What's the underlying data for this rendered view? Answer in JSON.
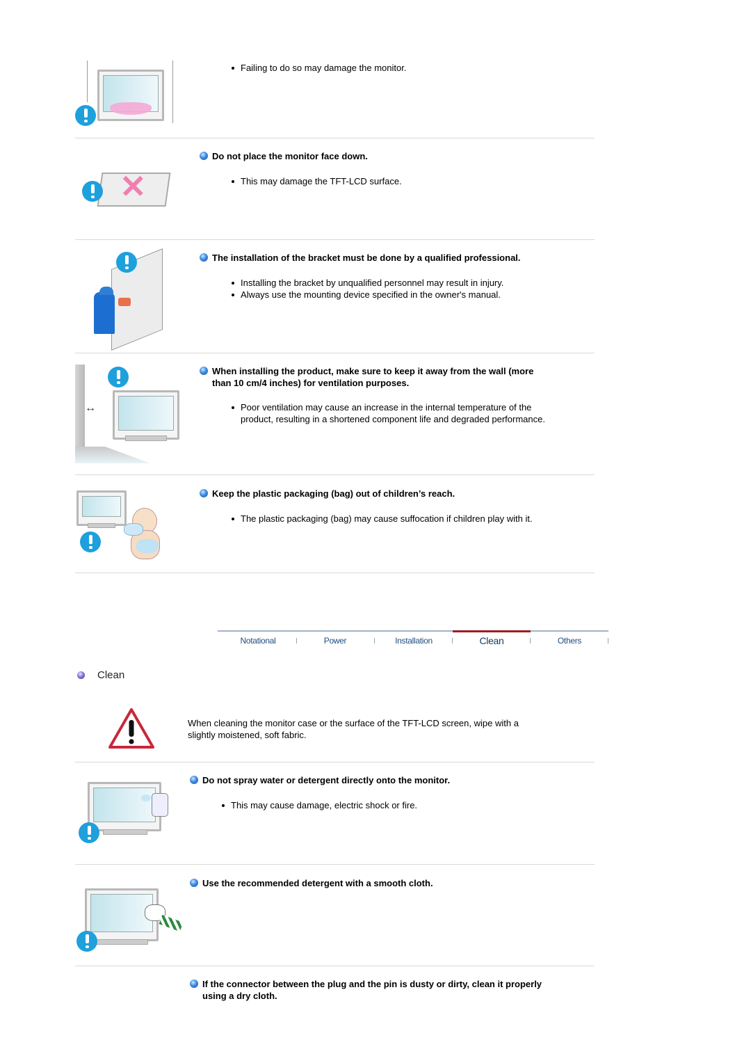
{
  "installation_items": [
    {
      "heading": "",
      "bullets": [
        "Failing to do so may damage the monitor."
      ]
    },
    {
      "heading": "Do not place the monitor face down.",
      "bullets": [
        "This may damage the TFT-LCD surface."
      ]
    },
    {
      "heading": "The installation of the bracket must be done by a qualified professional.",
      "bullets": [
        "Installing the bracket by unqualified personnel may result in injury.",
        "Always use the mounting device specified in the owner's manual."
      ]
    },
    {
      "heading_line1": "When installing the product, make sure to keep it away from the wall (more",
      "heading_line2": "than 10 cm/4 inches) for ventilation purposes.",
      "bullet_line1": "Poor ventilation may cause an increase in the internal temperature of the",
      "bullet_line2": "product, resulting in a shortened component life and degraded performance."
    },
    {
      "heading": "Keep the plastic packaging (bag) out of children’s reach.",
      "bullets": [
        "The plastic packaging (bag) may cause suffocation if children play with it."
      ]
    }
  ],
  "nav": {
    "tabs": [
      "Notational",
      "Power",
      "Installation",
      "Clean",
      "Others"
    ],
    "active": "Clean",
    "active_color": "#a01c22"
  },
  "clean_section": {
    "title": "Clean",
    "intro_line1": "When cleaning the monitor case or the surface of the TFT-LCD screen, wipe with a",
    "intro_line2": "slightly moistened, soft fabric.",
    "items": [
      {
        "heading": "Do not spray water or detergent directly onto the monitor.",
        "bullets": [
          "This may cause damage, electric shock or fire."
        ]
      },
      {
        "heading": "Use the recommended detergent with a smooth cloth."
      },
      {
        "heading_line1": "If the connector between the plug and the pin is dusty or dirty, clean it properly",
        "heading_line2": "using a dry cloth."
      }
    ]
  },
  "icons": {
    "warning": "exclamation-circle-icon",
    "caution": "caution-triangle-icon",
    "bullet": "blue-ball-icon"
  }
}
